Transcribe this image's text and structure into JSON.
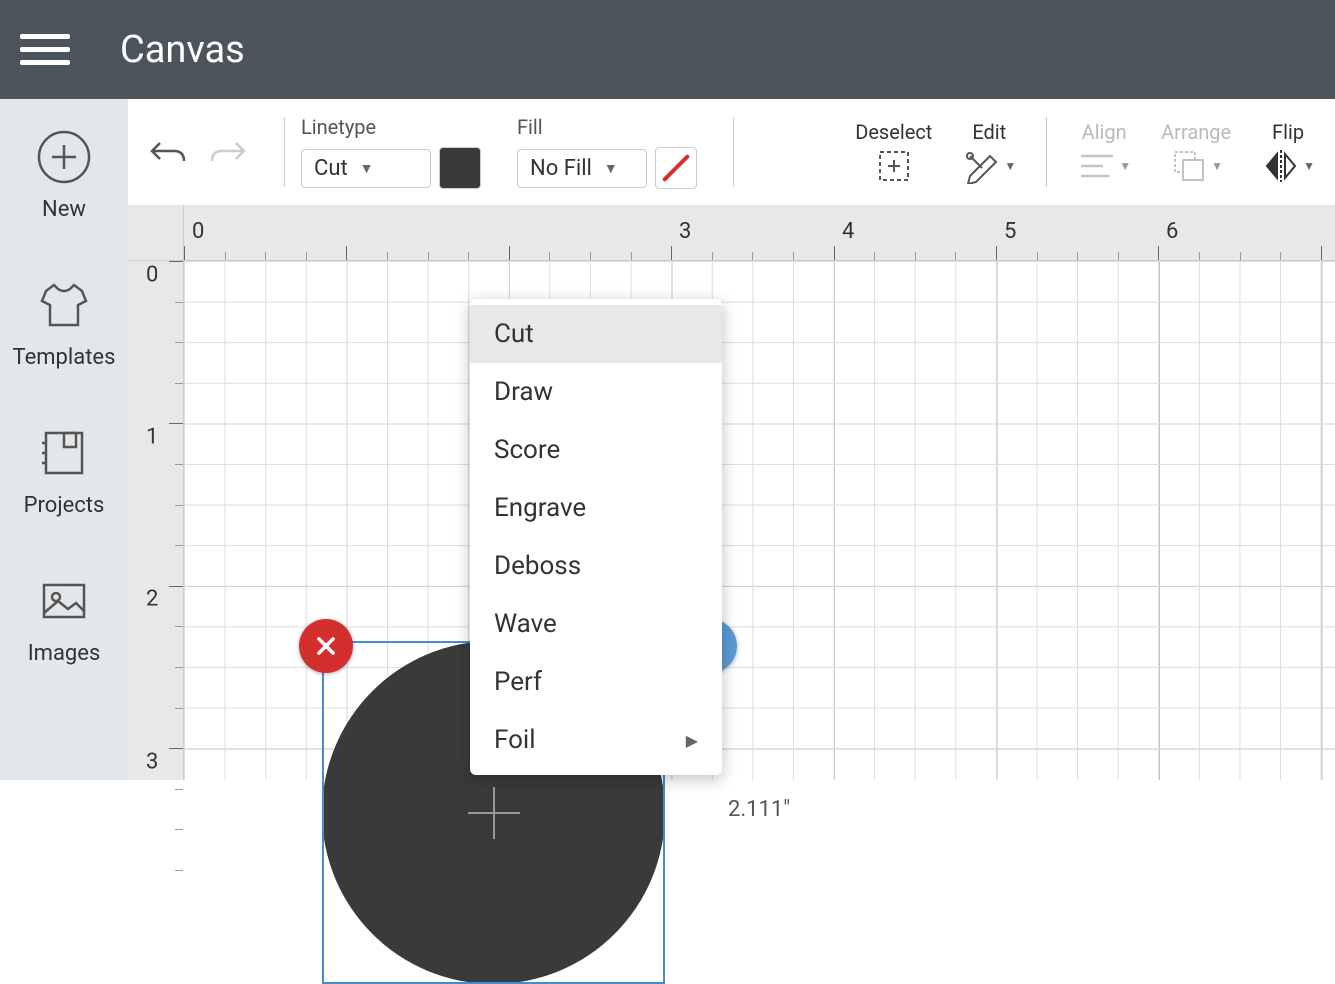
{
  "header": {
    "title": "Canvas"
  },
  "sidebar": {
    "items": [
      {
        "label": "New"
      },
      {
        "label": "Templates"
      },
      {
        "label": "Projects"
      },
      {
        "label": "Images"
      }
    ]
  },
  "toolbar": {
    "linetype": {
      "label": "Linetype",
      "value": "Cut"
    },
    "fill": {
      "label": "Fill",
      "value": "No Fill"
    },
    "actions": {
      "deselect": "Deselect",
      "edit": "Edit",
      "align": "Align",
      "arrange": "Arrange",
      "flip": "Flip"
    }
  },
  "linetype_menu": {
    "items": [
      "Cut",
      "Draw",
      "Score",
      "Engrave",
      "Deboss",
      "Wave",
      "Perf",
      "Foil"
    ],
    "active": "Cut",
    "submenu": [
      "Foil"
    ]
  },
  "ruler": {
    "h": [
      "0",
      "3",
      "4",
      "5",
      "6"
    ],
    "v": [
      "0",
      "1",
      "2",
      "3"
    ]
  },
  "selection": {
    "width_label": "2.111\""
  }
}
